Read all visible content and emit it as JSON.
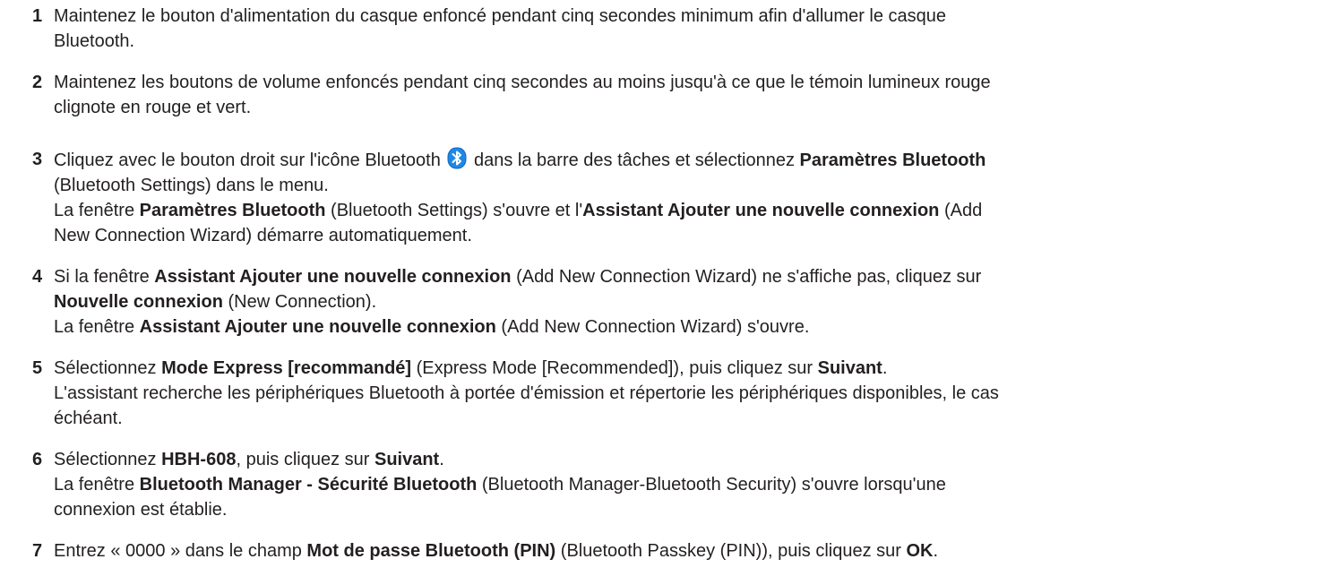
{
  "steps": [
    {
      "number": "1",
      "lines": [
        "Maintenez le bouton d'alimentation du casque enfoncé pendant cinq secondes minimum afin d'allumer le casque",
        "Bluetooth."
      ]
    },
    {
      "number": "2",
      "lines": [
        "Maintenez les boutons de volume enfoncés pendant cinq secondes au moins jusqu'à ce que le témoin lumineux rouge",
        "clignote en rouge et vert."
      ]
    },
    {
      "number": "3",
      "l1_a": "Cliquez avec le bouton droit sur l'icône Bluetooth",
      "l1_b": "dans la barre des tâches et sélectionnez",
      "l1_bold": "Paramètres Bluetooth",
      "l2": "(Bluetooth Settings) dans le menu.",
      "l3_a": "La fenêtre",
      "l3_bold1": "Paramètres Bluetooth",
      "l3_b": "(Bluetooth Settings) s'ouvre et l'",
      "l3_bold2": "Assistant Ajouter une nouvelle connexion",
      "l3_c": "(Add",
      "l4": "New Connection Wizard) démarre automatiquement.",
      "icon": "bluetooth-icon",
      "icon_color": "#1e88e5"
    },
    {
      "number": "4",
      "l1_a": "Si la fenêtre",
      "l1_bold": "Assistant Ajouter une nouvelle connexion",
      "l1_b": "(Add New Connection Wizard) ne s'affiche pas, cliquez sur",
      "l2_bold": "Nouvelle connexion",
      "l2_a": "(New Connection).",
      "l3_a": "La fenêtre",
      "l3_bold": "Assistant Ajouter une nouvelle connexion",
      "l3_b": "(Add New Connection Wizard) s'ouvre."
    },
    {
      "number": "5",
      "l1_a": "Sélectionnez",
      "l1_bold1": "Mode Express [recommandé]",
      "l1_b": "(Express Mode [Recommended]), puis cliquez sur",
      "l1_bold2": "Suivant",
      "l1_c": ".",
      "l2": "L'assistant recherche les périphériques Bluetooth à portée d'émission et répertorie les périphériques disponibles, le cas",
      "l3": "échéant."
    },
    {
      "number": "6",
      "l1_a": "Sélectionnez",
      "l1_bold1": "HBH-608",
      "l1_b": ", puis cliquez sur",
      "l1_bold2": "Suivant",
      "l1_c": ".",
      "l2_a": "La fenêtre",
      "l2_bold": "Bluetooth Manager - Sécurité Bluetooth",
      "l2_b": "(Bluetooth Manager-Bluetooth Security) s'ouvre lorsqu'une",
      "l3": "connexion est établie."
    },
    {
      "number": "7",
      "l1_a": "Entrez « 0000 » dans le champ",
      "l1_bold1": "Mot de passe Bluetooth (PIN)",
      "l1_b": "(Bluetooth Passkey (PIN)), puis cliquez sur",
      "l1_bold2": "OK",
      "l1_c": "."
    }
  ]
}
